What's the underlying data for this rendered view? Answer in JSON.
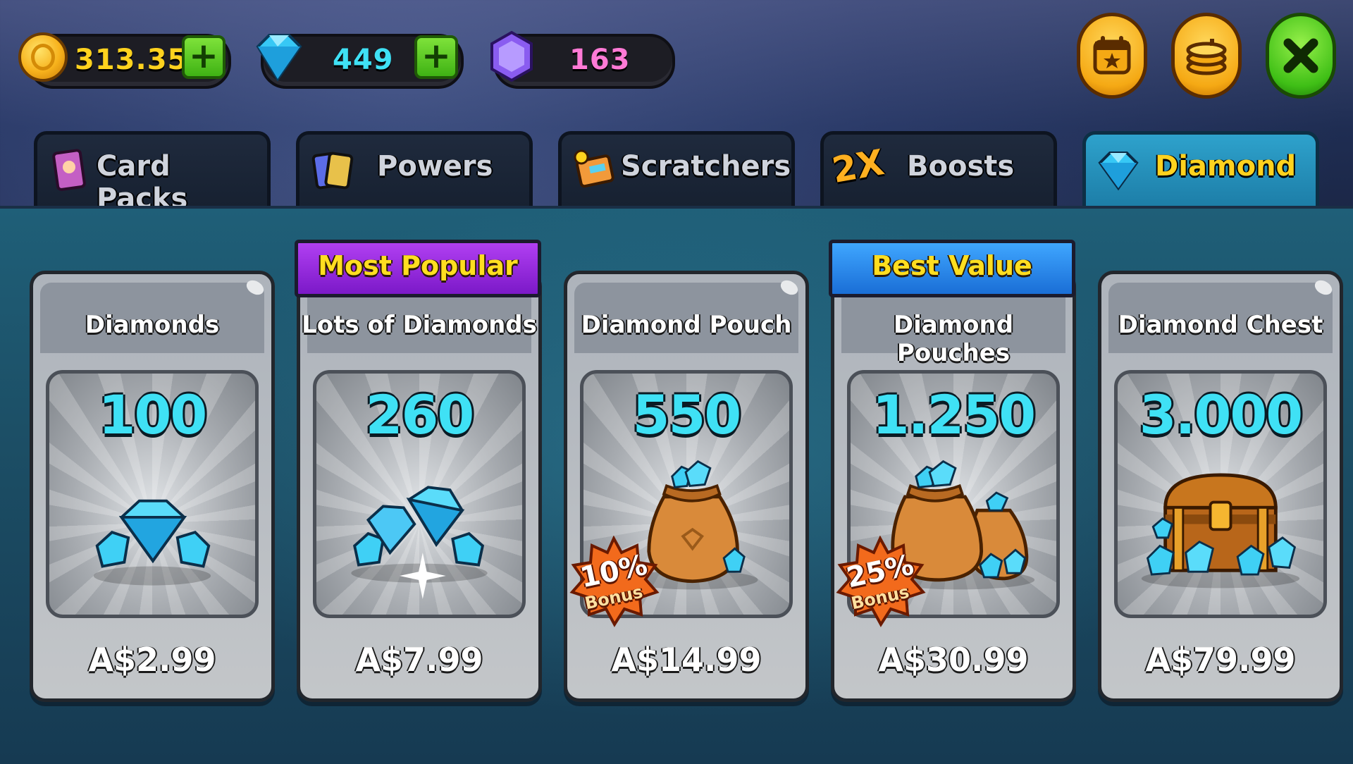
{
  "currencies": {
    "coins": "313.353",
    "diamonds": "449",
    "gems": "163"
  },
  "colors": {
    "coin_text": "#ffd21e",
    "diamond_text": "#3fe1f5",
    "gem_text": "#ff7ad6"
  },
  "top_buttons": [
    "calendar-star-icon",
    "stacked-coins-icon",
    "close-icon"
  ],
  "tabs": [
    {
      "label": "Card Packs",
      "icon": "card-pack-icon"
    },
    {
      "label": "Powers",
      "icon": "power-cards-icon"
    },
    {
      "label": "Scratchers",
      "icon": "scratcher-ticket-icon"
    },
    {
      "label": "2X",
      "label2": "Boosts",
      "icon": "2x-boost-icon"
    },
    {
      "label": "Diamond",
      "icon": "diamond-icon",
      "active": true
    }
  ],
  "ribbons": {
    "most_popular": "Most Popular",
    "best_value": "Best Value"
  },
  "products": [
    {
      "title": "Diamonds",
      "amount": "100",
      "price": "A$2.99",
      "art": "diamond-pile-icon"
    },
    {
      "title": "Lots of Diamonds",
      "amount": "260",
      "price": "A$7.99",
      "art": "diamond-pile-icon"
    },
    {
      "title": "Diamond Pouch",
      "amount": "550",
      "price": "A$14.99",
      "art": "diamond-pouch-icon",
      "bonus": "10%",
      "bonus_label": "Bonus"
    },
    {
      "title": "Diamond Pouches",
      "amount": "1.250",
      "price": "A$30.99",
      "art": "diamond-pouches-icon",
      "bonus": "25%",
      "bonus_label": "Bonus"
    },
    {
      "title": "Diamond Chest",
      "amount": "3.000",
      "price": "A$79.99",
      "art": "treasure-chest-icon"
    }
  ]
}
